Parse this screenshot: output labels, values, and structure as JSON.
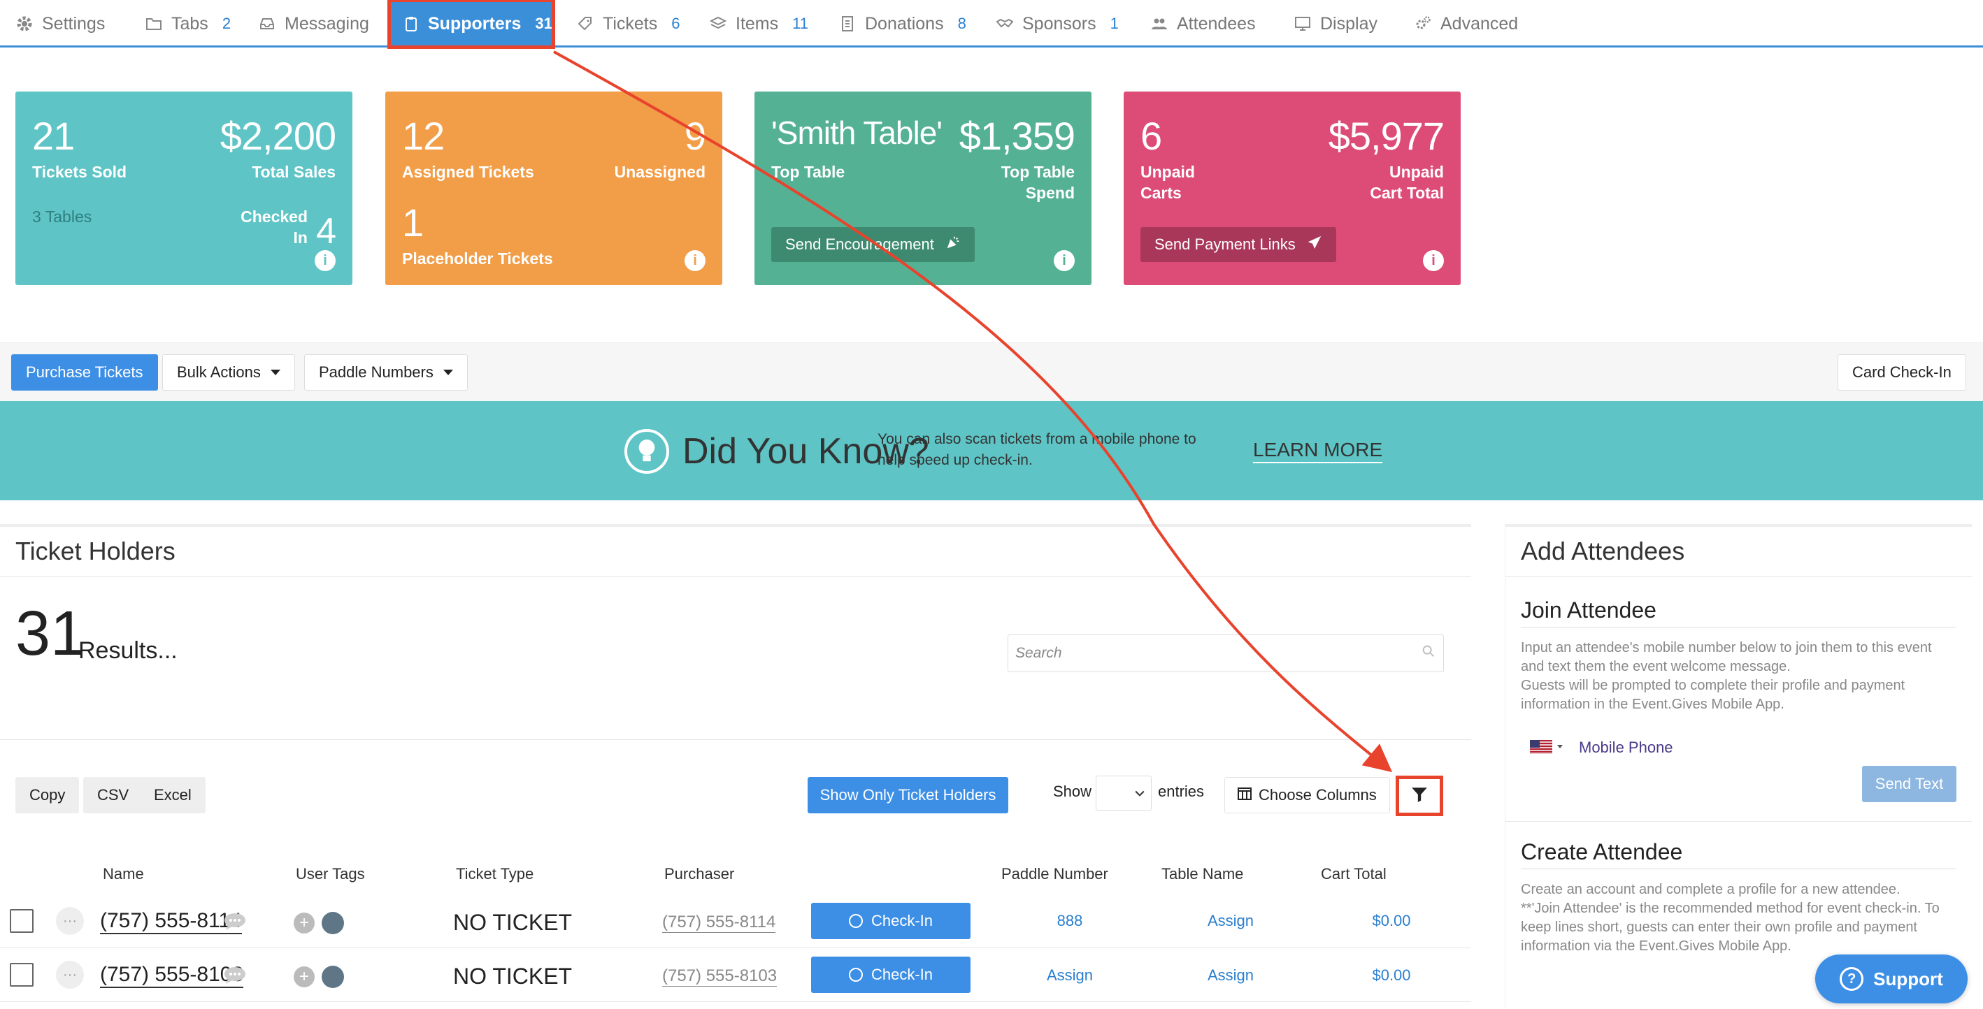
{
  "tabs": [
    {
      "label": "Settings",
      "count": "",
      "icon": "gear-icon"
    },
    {
      "label": "Tabs",
      "count": "2",
      "icon": "folder-icon"
    },
    {
      "label": "Messaging",
      "count": "",
      "icon": "inbox-icon"
    },
    {
      "label": "Supporters",
      "count": "31",
      "icon": "clipboard-icon"
    },
    {
      "label": "Tickets",
      "count": "6",
      "icon": "ticket-icon"
    },
    {
      "label": "Items",
      "count": "11",
      "icon": "layers-icon"
    },
    {
      "label": "Donations",
      "count": "8",
      "icon": "receipt-icon"
    },
    {
      "label": "Sponsors",
      "count": "1",
      "icon": "handshake-icon"
    },
    {
      "label": "Attendees",
      "count": "",
      "icon": "users-icon"
    },
    {
      "label": "Display",
      "count": "",
      "icon": "monitor-icon"
    },
    {
      "label": "Advanced",
      "count": "",
      "icon": "gears-icon"
    }
  ],
  "cards": {
    "tickets": {
      "sold_value": "21",
      "sold_label": "Tickets Sold",
      "sales_value": "$2,200",
      "sales_label": "Total Sales",
      "tables": "3 Tables",
      "checked_label": "Checked In",
      "checked_value": "4",
      "color": "#5ec4c5"
    },
    "assigned": {
      "assigned_value": "12",
      "assigned_label": "Assigned Tickets",
      "unassigned_value": "9",
      "unassigned_label": "Unassigned",
      "placeholder_value": "1",
      "placeholder_label": "Placeholder Tickets",
      "color": "#f29d47"
    },
    "table": {
      "top_table_value": "'Smith Table'",
      "top_table_label": "Top Table",
      "spend_value": "$1,359",
      "spend_label": "Top Table Spend",
      "button": "Send Encouragement",
      "color": "#55b193"
    },
    "carts": {
      "unpaid_value": "6",
      "unpaid_label": "Unpaid Carts",
      "total_value": "$5,977",
      "total_label": "Unpaid Cart Total",
      "button": "Send Payment Links",
      "color": "#dc4c77"
    }
  },
  "toolbar": {
    "purchase": "Purchase Tickets",
    "bulk": "Bulk Actions",
    "paddle": "Paddle Numbers",
    "card_checkin": "Card Check-In"
  },
  "banner": {
    "title": "Did You Know?",
    "text": "You can also scan tickets from a mobile phone to help speed up check-in.",
    "link": "LEARN MORE"
  },
  "holders": {
    "title": "Ticket Holders",
    "count": "31",
    "count_label": "Results...",
    "search_placeholder": "Search",
    "export": [
      "Copy",
      "CSV",
      "Excel"
    ],
    "show_only": "Show Only Ticket Holders",
    "show": "Show",
    "entries": "entries",
    "choose_columns": "Choose Columns",
    "columns": [
      "Name",
      "User Tags",
      "Ticket Type",
      "Purchaser",
      "Paddle Number",
      "Table Name",
      "Cart Total"
    ],
    "rows": [
      {
        "name": "(757) 555-8114",
        "ticket_type": "NO TICKET",
        "purchaser": "(757) 555-8114",
        "checkin": "Check-In",
        "paddle": "888",
        "table": "Assign",
        "cart": "$0.00"
      },
      {
        "name": "(757) 555-8103",
        "ticket_type": "NO TICKET",
        "purchaser": "(757) 555-8103",
        "checkin": "Check-In",
        "paddle": "Assign",
        "table": "Assign",
        "cart": "$0.00"
      }
    ]
  },
  "attendees": {
    "title": "Add Attendees",
    "join_title": "Join Attendee",
    "join_desc_1": "Input an attendee's mobile number below to join them to this event and text them the event welcome message.",
    "join_desc_2": "Guests will be prompted to complete their profile and payment information in the Event.Gives Mobile App.",
    "mobile_label": "Mobile Phone",
    "send_text": "Send Text",
    "create_title": "Create Attendee",
    "create_desc_1": "Create an account and complete a profile for a new attendee.",
    "create_desc_2": "**'Join Attendee' is the recommended method for event check-in. To keep lines short, guests can enter their own profile and payment information via the Event.Gives Mobile App."
  },
  "support": "Support",
  "colors": {
    "accent": "#3d8fe6",
    "annotation": "#e8432d"
  }
}
